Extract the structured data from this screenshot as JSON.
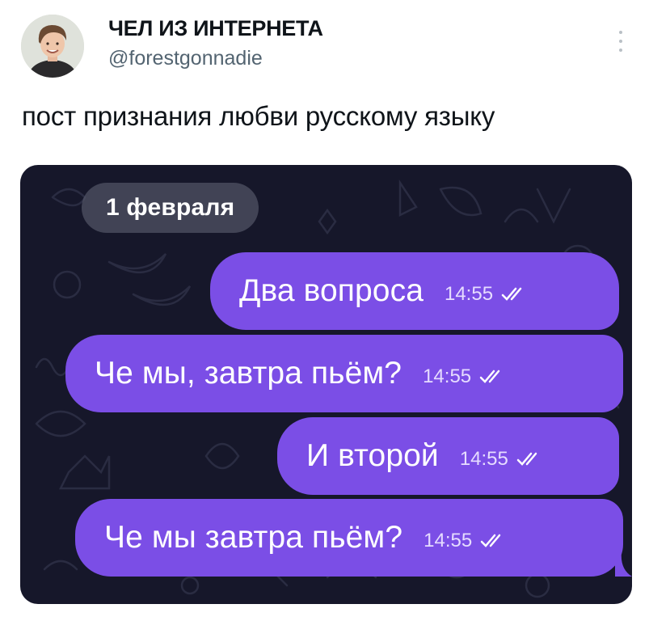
{
  "author": {
    "display_name": "ЧЕЛ ИЗ ИНТЕРНЕТА",
    "handle": "@forestgonnadie",
    "avatar_icon": "user-photo"
  },
  "tweet": {
    "text": "пост признания любви русскому языку",
    "more_icon": "vertical-ellipsis-icon"
  },
  "chat": {
    "date_label": "1 февраля",
    "bubble_color": "#7b4ee6",
    "background_color": "#16172a",
    "messages": [
      {
        "text": "Два вопроса",
        "time": "14:55",
        "status_icon": "double-check-icon"
      },
      {
        "text": "Че мы, завтра пьём?",
        "time": "14:55",
        "status_icon": "double-check-icon"
      },
      {
        "text": "И второй",
        "time": "14:55",
        "status_icon": "double-check-icon"
      },
      {
        "text": "Че мы завтра пьём?",
        "time": "14:55",
        "status_icon": "double-check-icon"
      }
    ]
  }
}
